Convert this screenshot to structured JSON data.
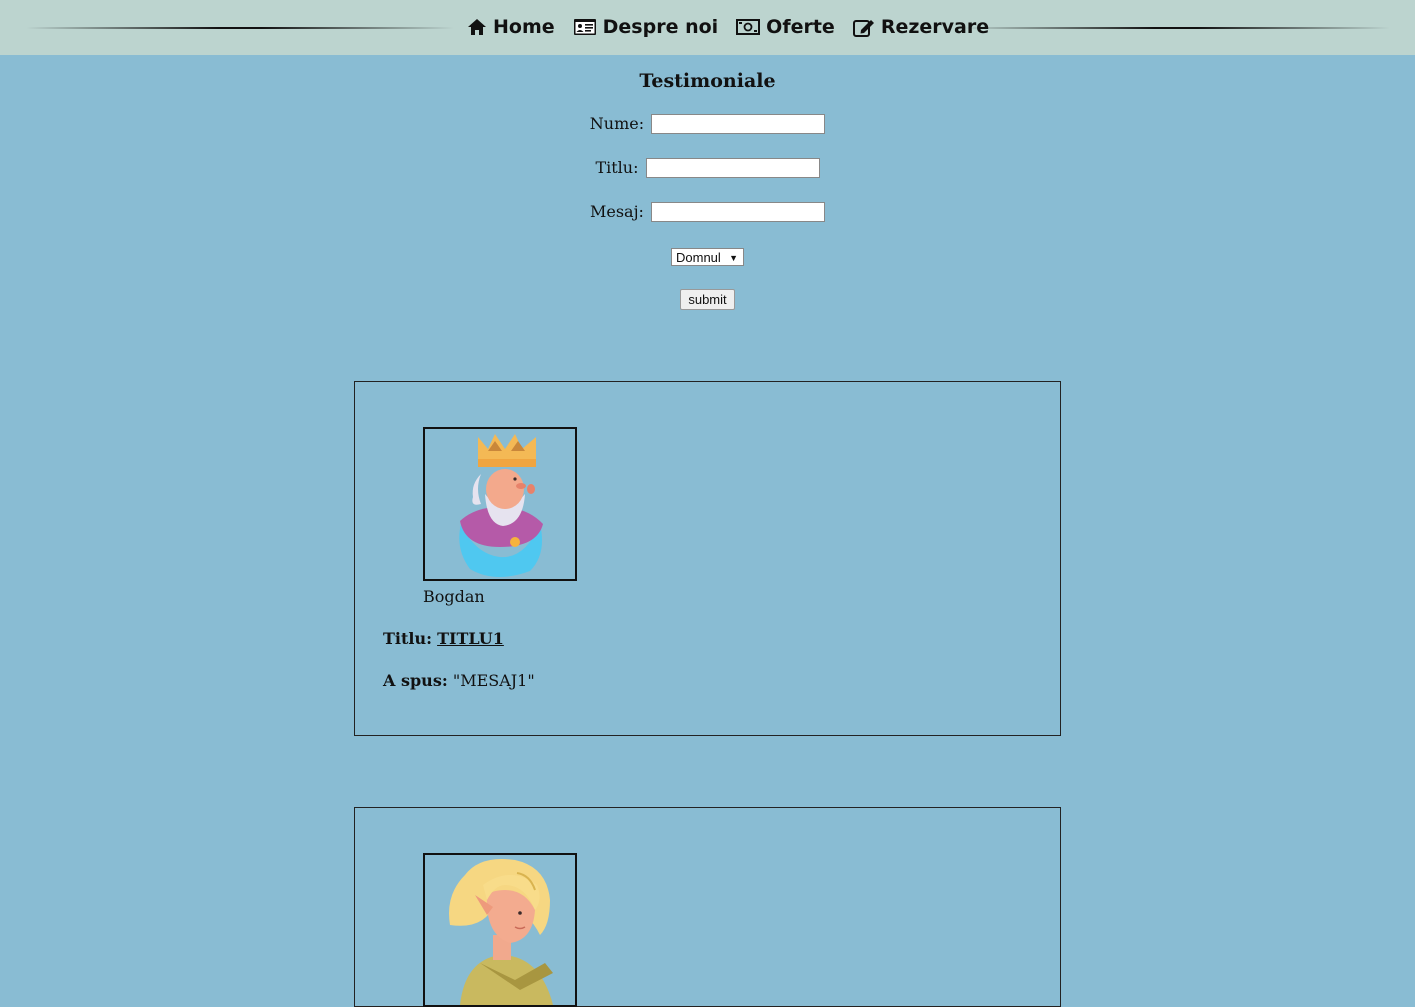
{
  "nav": {
    "items": [
      {
        "label": "Home",
        "icon": "home-icon"
      },
      {
        "label": "Despre noi",
        "icon": "id-card-icon"
      },
      {
        "label": "Oferte",
        "icon": "money-icon"
      },
      {
        "label": "Rezervare",
        "icon": "edit-icon"
      }
    ]
  },
  "form": {
    "title": "Testimoniale",
    "name_label": "Nume:",
    "name_value": "",
    "title_label": "Titlu:",
    "title_value": "",
    "message_label": "Mesaj:",
    "message_value": "",
    "salutation_selected": "Domnul",
    "submit_label": "submit"
  },
  "testimonials": [
    {
      "avatar": "king-avatar",
      "name": "Bogdan",
      "title_label": "Titlu:",
      "title_value": "TITLU1",
      "message_label": "A spus:",
      "message_value": "\"MESAJ1\""
    },
    {
      "avatar": "elf-avatar"
    }
  ],
  "colors": {
    "page_background": "#89bcd3",
    "nav_background": "#bcd4cf"
  }
}
